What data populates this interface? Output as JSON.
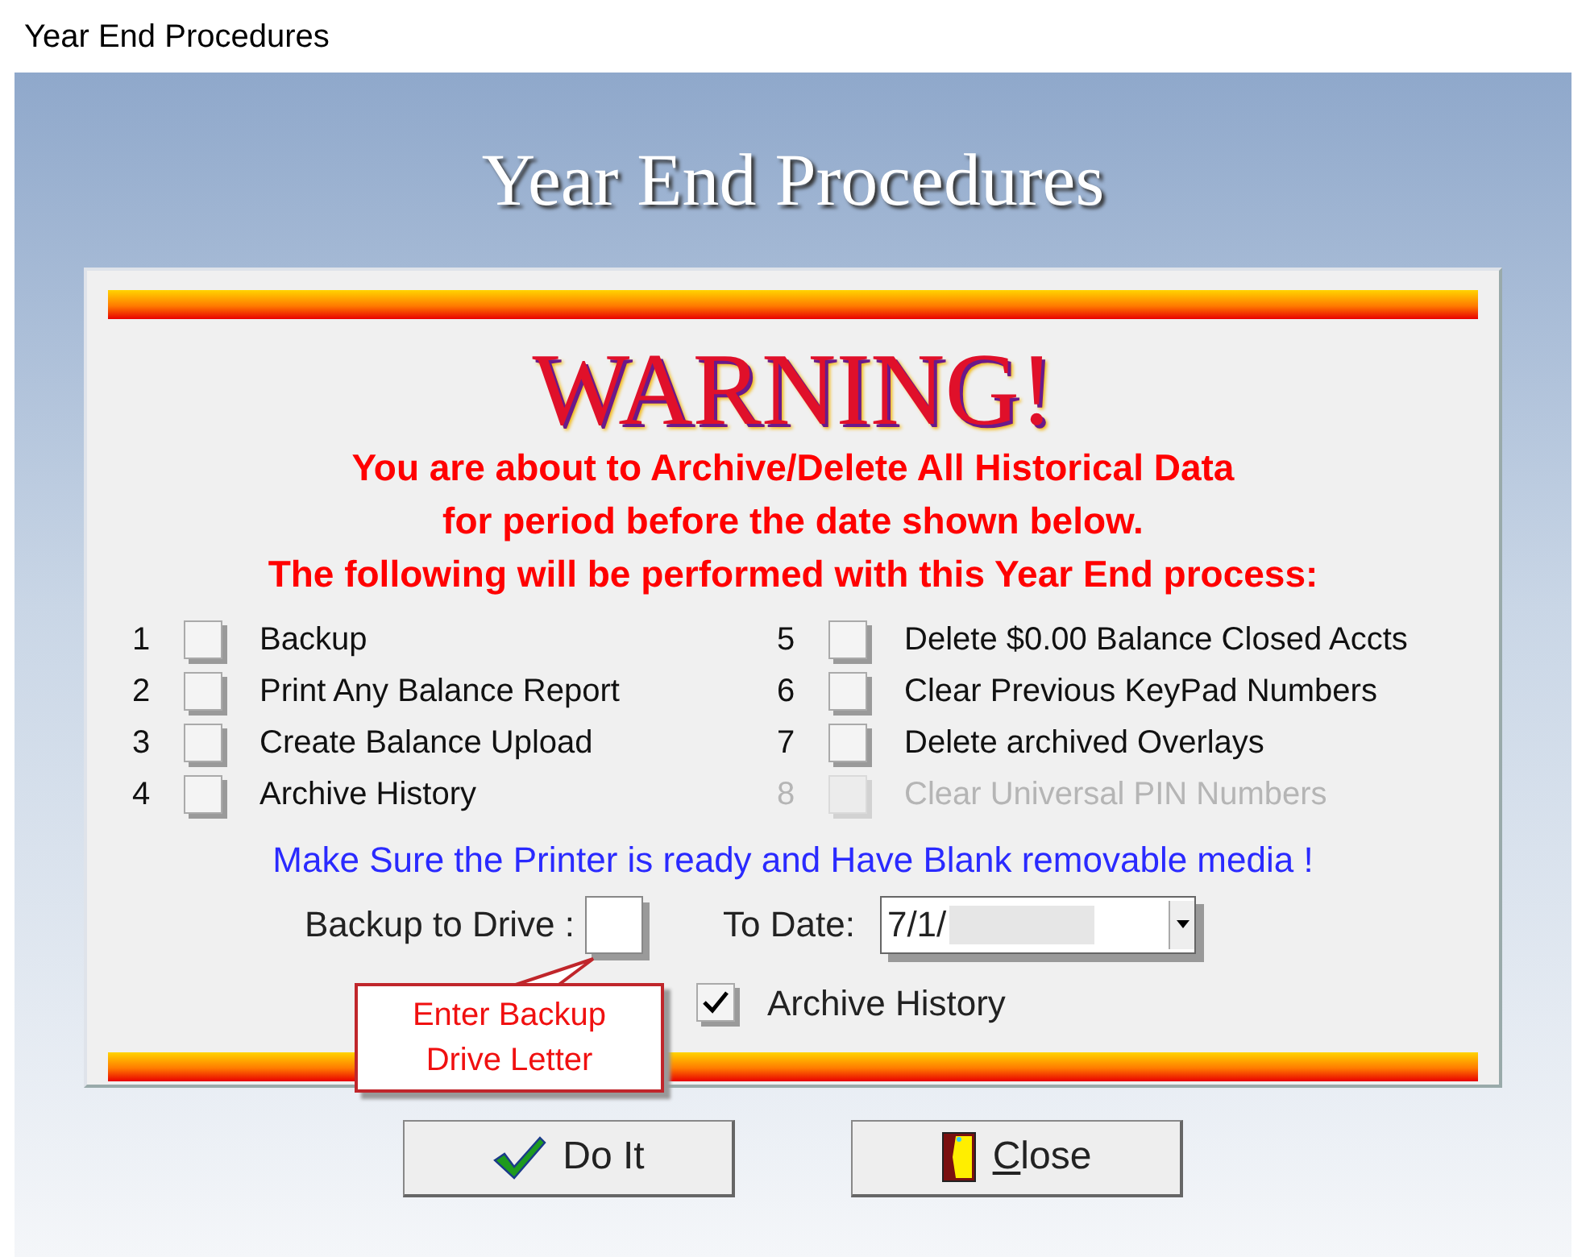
{
  "window": {
    "title": "Year End Procedures"
  },
  "heading": "Year End Procedures",
  "warning": {
    "title": "WARNING!",
    "lines": [
      "You are about to Archive/Delete All Historical Data",
      "for period before the date shown below.",
      "The following will be performed with this Year End process:"
    ]
  },
  "steps": [
    {
      "number": "1",
      "label": "Backup",
      "checked": false,
      "disabled": false
    },
    {
      "number": "2",
      "label": "Print Any Balance Report",
      "checked": false,
      "disabled": false
    },
    {
      "number": "3",
      "label": "Create Balance Upload",
      "checked": false,
      "disabled": false
    },
    {
      "number": "4",
      "label": "Archive History",
      "checked": false,
      "disabled": false
    },
    {
      "number": "5",
      "label": "Delete $0.00 Balance Closed Accts",
      "checked": false,
      "disabled": false
    },
    {
      "number": "6",
      "label": "Clear Previous KeyPad Numbers",
      "checked": false,
      "disabled": false
    },
    {
      "number": "7",
      "label": "Delete archived Overlays",
      "checked": false,
      "disabled": false
    },
    {
      "number": "8",
      "label": "Clear Universal PIN Numbers",
      "checked": false,
      "disabled": true
    }
  ],
  "notice": "Make Sure the Printer is ready and Have Blank removable media !",
  "backup_drive": {
    "label": "Backup to Drive :"
  },
  "to_date": {
    "label": "To Date:",
    "value": "7/1/"
  },
  "archive_history": {
    "label": "Archive History",
    "checked": true
  },
  "callout": {
    "lines": [
      "Enter Backup",
      "Drive Letter"
    ]
  },
  "buttons": [
    {
      "label": "Do It",
      "kind": "ok",
      "mnemonic": false
    },
    {
      "label": "Close",
      "kind": "close",
      "mnemonic": true
    }
  ]
}
